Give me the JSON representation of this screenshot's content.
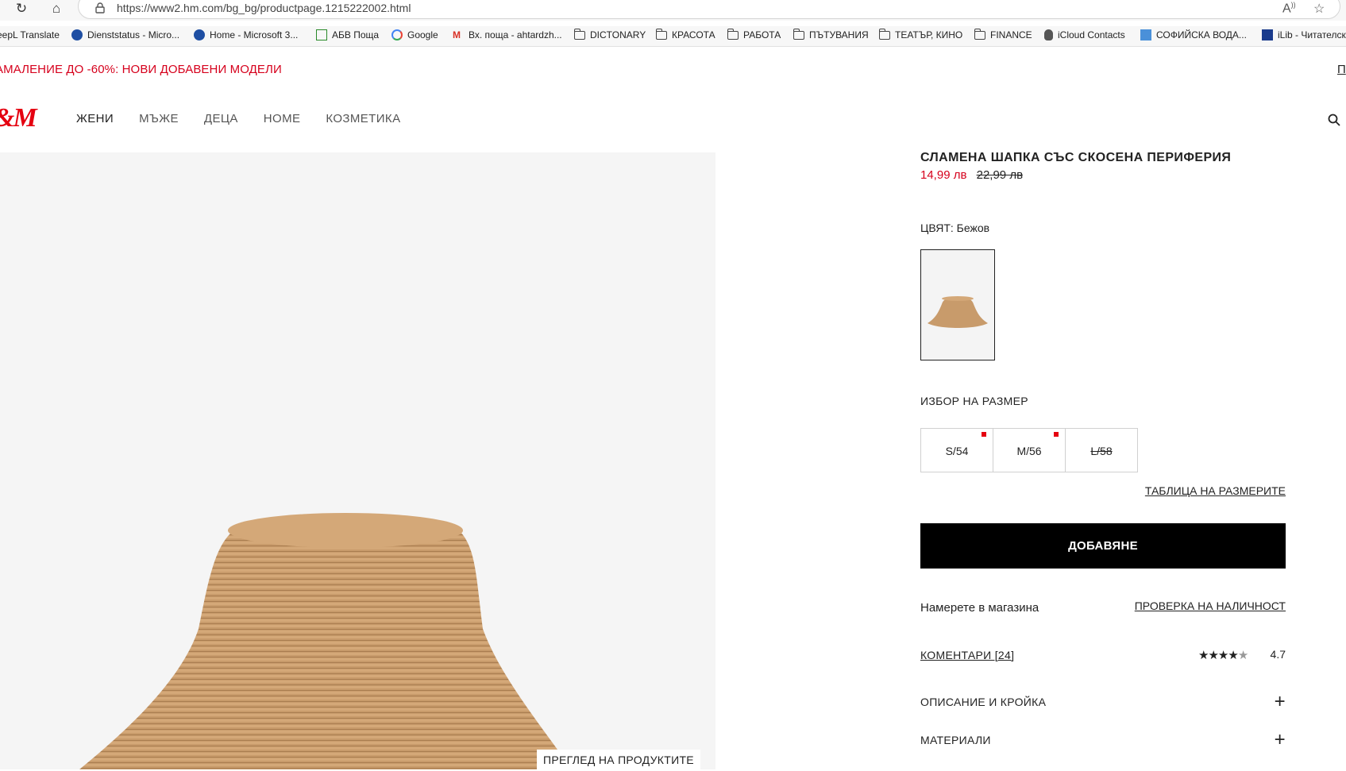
{
  "browser": {
    "url": "https://www2.hm.com/bg_bg/productpage.1215222002.html",
    "read_aloud_icon": "read-aloud-icon",
    "favorite_icon": "star-outline-icon"
  },
  "bookmarks": [
    {
      "label": "eepL Translate",
      "icon": "deepl-icon"
    },
    {
      "label": "Dienststatus - Micro...",
      "icon": "ms-admin-icon"
    },
    {
      "label": "Home - Microsoft 3...",
      "icon": "ms-admin-icon"
    },
    {
      "label": "АБВ Поща",
      "icon": "house-icon"
    },
    {
      "label": "Google",
      "icon": "google-icon"
    },
    {
      "label": "Вх. поща - ahtardzh...",
      "icon": "gmail-icon"
    },
    {
      "label": "DICTONARY",
      "icon": "folder-icon"
    },
    {
      "label": "КРАСОТА",
      "icon": "folder-icon"
    },
    {
      "label": "РАБОТА",
      "icon": "folder-icon"
    },
    {
      "label": "ПЪТУВАНИЯ",
      "icon": "folder-icon"
    },
    {
      "label": "ТЕАТЪР, КИНО",
      "icon": "folder-icon"
    },
    {
      "label": "FINANCE",
      "icon": "folder-icon"
    },
    {
      "label": "iCloud Contacts",
      "icon": "apple-icon"
    },
    {
      "label": "СОФИЙСКА ВОДА...",
      "icon": "water-icon"
    },
    {
      "label": "iLib - Читателск",
      "icon": "ilib-icon"
    }
  ],
  "promo": {
    "text": "АМАЛЕНИЕ ДО -60%: НОВИ ДОБАВЕНИ МОДЕЛИ",
    "right_text": "П"
  },
  "header": {
    "logo": "&M",
    "nav": [
      "ЖЕНИ",
      "МЪЖЕ",
      "ДЕЦА",
      "HOME",
      "КОЗМЕТИКА"
    ]
  },
  "product": {
    "title": "СЛАМЕНА ШАПКА СЪС СКОСЕНА ПЕРИФЕРИЯ",
    "price_sale": "14,99 лв",
    "price_old": "22,99 лв",
    "color_label": "ЦВЯТ: Бежов",
    "size_label": "ИЗБОР НА РАЗМЕР",
    "sizes": [
      {
        "label": "S/54",
        "few_left": true,
        "sold_out": false
      },
      {
        "label": "M/56",
        "few_left": true,
        "sold_out": false
      },
      {
        "label": "L/58",
        "few_left": false,
        "sold_out": true
      }
    ],
    "size_chart": "ТАБЛИЦА НА РАЗМЕРИТЕ",
    "add_button": "ДОБАВЯНЕ",
    "store_label": "Намерете в магазина",
    "availability_link": "ПРОВЕРКА НА НАЛИЧНОСТ",
    "reviews_link": "КОМЕНТАРИ [24]",
    "rating_value": 4.7,
    "rating": "4.7",
    "accordions": [
      "ОПИСАНИЕ И КРОЙКА",
      "МАТЕРИАЛИ"
    ],
    "overview_button": "ПРЕГЛЕД НА ПРОДУКТИТЕ"
  },
  "colors": {
    "sale_red": "#d6001c",
    "brand_red": "#e50010",
    "button_black": "#000000"
  }
}
